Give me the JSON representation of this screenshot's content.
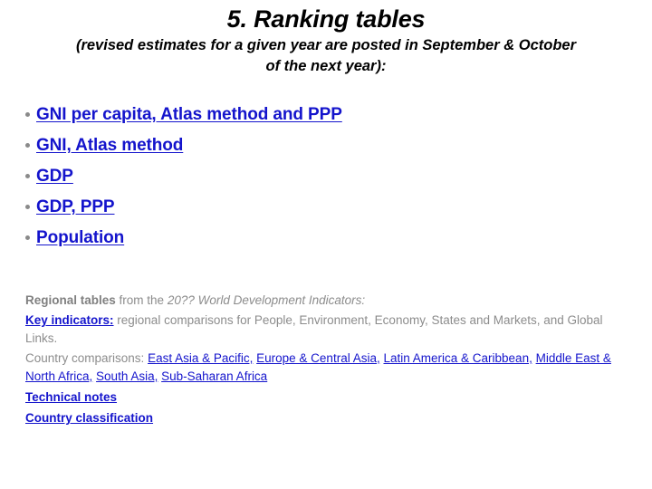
{
  "slide": {
    "title": "5. Ranking tables",
    "subtitle_line1": "(revised estimates for a given year are posted in September & October",
    "subtitle_line2": "of the next year):"
  },
  "bullets": [
    {
      "label": "GNI per capita, Atlas method and PPP"
    },
    {
      "label": "GNI, Atlas method"
    },
    {
      "label": "GDP"
    },
    {
      "label": "GDP, PPP"
    },
    {
      "label": "Population"
    }
  ],
  "notes": {
    "regional_tables_label": "Regional tables",
    "regional_tables_from": " from the ",
    "regional_tables_source": "20?? World Development Indicators:",
    "key_indicators_link": "Key indicators:",
    "key_indicators_text": " regional comparisons for People, Environment, Economy, States and Markets, and Global Links.",
    "country_comparisons_label": "Country comparisons: ",
    "country_links": [
      "East Asia & Pacific,",
      "Europe & Central Asia,",
      "Latin America & Caribbean,",
      "Middle East & North Africa,",
      "South Asia,",
      "Sub-Saharan Africa"
    ],
    "technical_notes_link": "Technical notes",
    "country_classification_link": "Country classification"
  },
  "colors": {
    "link_blue": "#1414cc",
    "body_gray": "#8c8c8c",
    "bullet_gray": "#8a8a8a",
    "title_black": "#000000",
    "background": "#ffffff"
  }
}
